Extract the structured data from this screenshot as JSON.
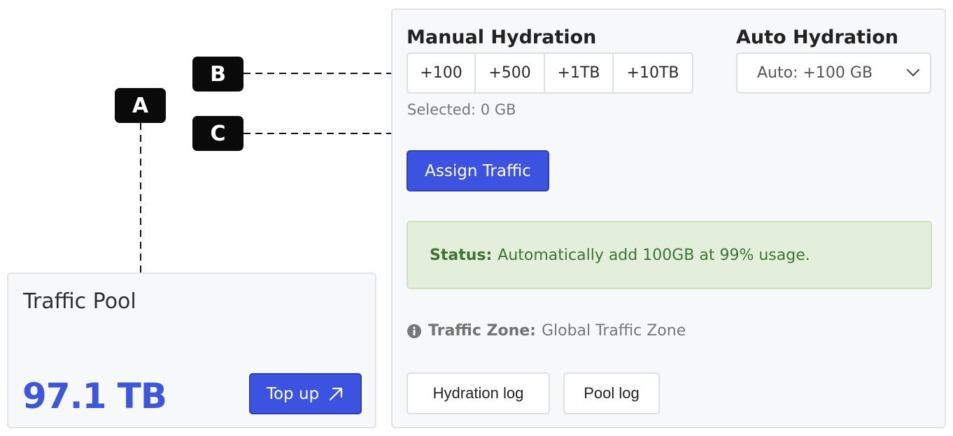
{
  "callouts": {
    "a": "A",
    "b": "B",
    "c": "C"
  },
  "pool": {
    "title": "Traffic Pool",
    "value": "97.1 TB",
    "top_up_label": "Top up"
  },
  "manual": {
    "title": "Manual Hydration",
    "options": [
      "+100",
      "+500",
      "+1TB",
      "+10TB"
    ],
    "selected": "Selected: 0 GB"
  },
  "auto": {
    "title": "Auto Hydration",
    "selected_value": "Auto: +100 GB"
  },
  "assign_label": "Assign Traffic",
  "status": {
    "label": "Status:",
    "text": "Automatically add 100GB at 99% usage."
  },
  "zone": {
    "label": "Traffic Zone:",
    "value": "Global Traffic Zone"
  },
  "logs": {
    "hydration": "Hydration log",
    "pool": "Pool log"
  },
  "colors": {
    "accent": "#3c52e0",
    "value_blue": "#3d56db",
    "status_bg": "#e3efdb",
    "status_text": "#3e7434"
  },
  "icons": {
    "top_up": "arrow-up-right-icon",
    "dropdown": "chevron-down-icon",
    "zone": "info-circle-icon"
  }
}
